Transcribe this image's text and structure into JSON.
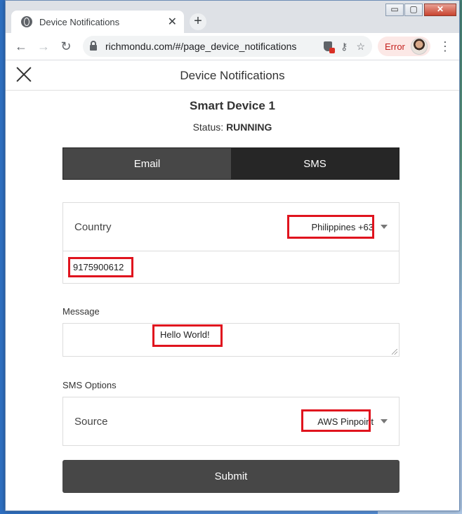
{
  "browser": {
    "tab_title": "Device Notifications",
    "tab_close": "✕",
    "new_tab": "+",
    "url": "richmondu.com/#/page_device_notifications",
    "error_label": "Error",
    "window_min": "▭",
    "window_max": "▢",
    "window_close": "✕"
  },
  "page": {
    "title": "Device Notifications",
    "device_name": "Smart Device 1",
    "status_label": "Status:",
    "status_value": "RUNNING"
  },
  "tabs": [
    {
      "label": "Email",
      "active": false
    },
    {
      "label": "SMS",
      "active": true
    }
  ],
  "recipient": {
    "country_label": "Country",
    "country_value": "Philippines +63",
    "phone_number": "9175900612"
  },
  "message": {
    "label": "Message",
    "value": "Hello World!"
  },
  "sms_options": {
    "label": "SMS Options",
    "source_label": "Source",
    "source_value": "AWS Pinpoint"
  },
  "submit_label": "Submit",
  "colors": {
    "highlight": "#e0141e",
    "dark_button": "#474747",
    "active_tab": "#262626"
  }
}
